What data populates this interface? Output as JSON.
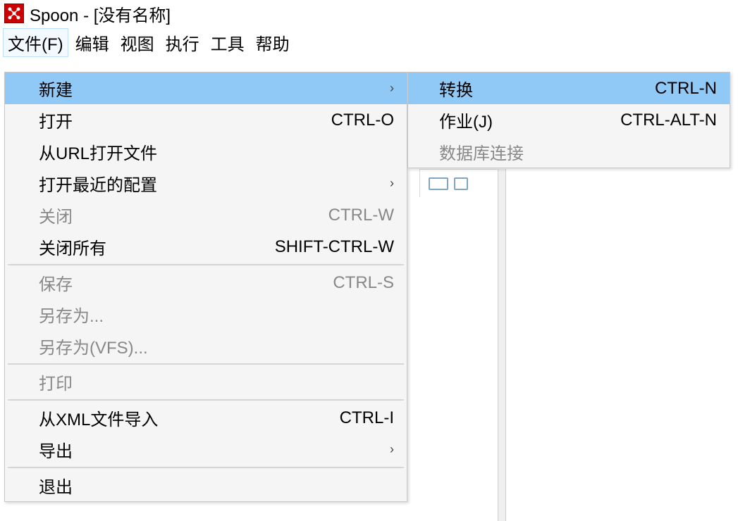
{
  "titlebar": {
    "title": "Spoon - [没有名称]"
  },
  "menubar": {
    "items": [
      {
        "label": "文件(F)"
      },
      {
        "label": "编辑"
      },
      {
        "label": "视图"
      },
      {
        "label": "执行"
      },
      {
        "label": "工具"
      },
      {
        "label": "帮助"
      }
    ]
  },
  "file_menu": {
    "new": {
      "label": "新建",
      "arrow": "›"
    },
    "open": {
      "label": "打开",
      "shortcut": "CTRL-O"
    },
    "open_url": {
      "label": "从URL打开文件"
    },
    "open_recent": {
      "label": "打开最近的配置",
      "arrow": "›"
    },
    "close": {
      "label": "关闭",
      "shortcut": "CTRL-W"
    },
    "close_all": {
      "label": "关闭所有",
      "shortcut": "SHIFT-CTRL-W"
    },
    "save": {
      "label": "保存",
      "shortcut": "CTRL-S"
    },
    "save_as": {
      "label": "另存为..."
    },
    "save_as_vfs": {
      "label": "另存为(VFS)..."
    },
    "print": {
      "label": "打印"
    },
    "import_xml": {
      "label": "从XML文件导入",
      "shortcut": "CTRL-I"
    },
    "export": {
      "label": "导出",
      "arrow": "›"
    },
    "exit": {
      "label": "退出"
    }
  },
  "new_submenu": {
    "transformation": {
      "label": "转换",
      "shortcut": "CTRL-N"
    },
    "job": {
      "label": "作业(J)",
      "shortcut": "CTRL-ALT-N"
    },
    "db_conn": {
      "label": "数据库连接"
    }
  }
}
